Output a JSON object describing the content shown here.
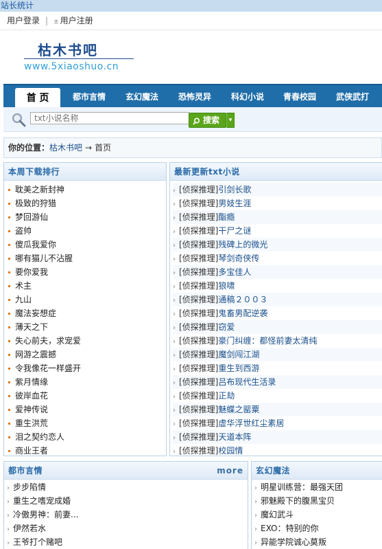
{
  "top_bar": {
    "stat_link": "站长统计"
  },
  "user_bar": {
    "login": "用户登录",
    "separator": "|",
    "register_icon": "±",
    "register": "用户注册"
  },
  "logo": {
    "name": "枯木书吧",
    "url": "www.5xiaoshuo.cn"
  },
  "nav": {
    "items": [
      {
        "label": "首 页",
        "active": true
      },
      {
        "label": "都市言情"
      },
      {
        "label": "玄幻魔法"
      },
      {
        "label": "恐怖灵异"
      },
      {
        "label": "科幻小说"
      },
      {
        "label": "青春校园"
      },
      {
        "label": "武侠武打"
      }
    ]
  },
  "search": {
    "placeholder": "txt小说名称",
    "button": "搜索",
    "dropdown_icon": "▾"
  },
  "location": {
    "label": "你的位置：",
    "site": "枯木书吧",
    "arrow": "→",
    "current": "首页"
  },
  "weekly_rank": {
    "title": "本周下载排行",
    "items": [
      "耽美之新封神",
      "极致的狩猎",
      "梦回游仙",
      "盗帅",
      "傻瓜我爱你",
      "哪有猫儿不沾腥",
      "要你爱我",
      "术主",
      "九山",
      "魔法妄想症",
      "薄天之下",
      "失心前夫，求宠爱",
      "网游之震撼",
      "令我像花一样盛开",
      "紫月情缘",
      "彼岸血花",
      "爱神传说",
      "重生洪荒",
      "泪之契约恋人",
      "商业王者"
    ]
  },
  "latest": {
    "title": "最新更新txt小说",
    "category": "[侦探推理]",
    "items": [
      "引剑长歌",
      "男妓生涯",
      "酯瘾",
      "干尸之谜",
      "残碑上的微光",
      "琴剑奇侠传",
      "多宝佳人",
      "狼啸",
      "通稿２００３",
      "鬼畜男配逆袭",
      "窃爱",
      "豪门纠缠：都怪前妻太清纯",
      "魔剑闯江湖",
      "重生到西游",
      "吕布现代生活录",
      "正劫",
      "魅蝶之罂粟",
      "虚华浮世红尘素居",
      "天道本阵",
      "校园情"
    ]
  },
  "urban": {
    "title": "都市言情",
    "more": "more",
    "items": [
      "步步陷情",
      "重生之嗜宠成婚",
      "冷傲男神：前妻...",
      "伊然若水",
      "王爷打个赌吧"
    ]
  },
  "fantasy": {
    "title": "玄幻魔法",
    "items": [
      "明星训练营：最强天团",
      "邪魅殿下的腹黑宝贝",
      "魔幻武斗",
      "EXO：特别的你",
      "异能学院诚心莫叛"
    ]
  },
  "colors": {
    "nav_bg": "#1f6ea9",
    "link": "#1a4f8c",
    "bullet": "#e07a1a",
    "search_btn": "#5aa51c"
  }
}
